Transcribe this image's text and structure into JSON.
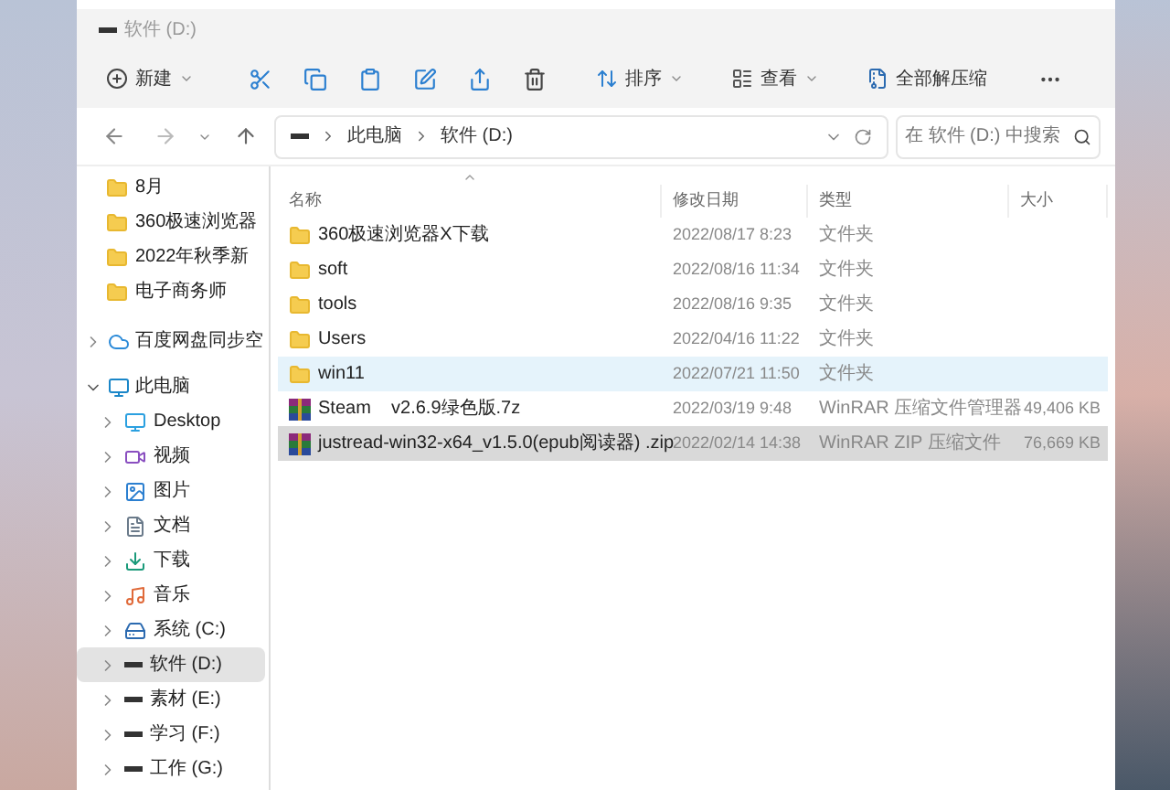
{
  "window": {
    "title": "软件 (D:)"
  },
  "toolbar": {
    "new": "新建",
    "sort": "排序",
    "view": "查看",
    "extract": "全部解压缩"
  },
  "address": {
    "breadcrumbs": [
      "此电脑",
      "软件 (D:)"
    ],
    "search_placeholder": "在 软件 (D:) 中搜索"
  },
  "sidebar": {
    "quick_access": [
      {
        "label": "8月"
      },
      {
        "label": "360极速浏览器"
      },
      {
        "label": "2022年秋季新"
      },
      {
        "label": "电子商务师"
      }
    ],
    "items": [
      {
        "label": "百度网盘同步空",
        "kind": "cloud",
        "expanded": false
      },
      {
        "label": "此电脑",
        "kind": "pc",
        "expanded": true,
        "children": [
          {
            "label": "Desktop",
            "kind": "desktop",
            "selected": false
          },
          {
            "label": "视频",
            "kind": "video",
            "selected": false
          },
          {
            "label": "图片",
            "kind": "picture",
            "selected": false
          },
          {
            "label": "文档",
            "kind": "document",
            "selected": false
          },
          {
            "label": "下载",
            "kind": "download",
            "selected": false
          },
          {
            "label": "音乐",
            "kind": "music",
            "selected": false
          },
          {
            "label": "系统 (C:)",
            "kind": "system-drive",
            "selected": false
          },
          {
            "label": "软件 (D:)",
            "kind": "drive",
            "selected": true
          },
          {
            "label": "素材 (E:)",
            "kind": "drive",
            "selected": false
          },
          {
            "label": "学习 (F:)",
            "kind": "drive",
            "selected": false
          },
          {
            "label": "工作 (G:)",
            "kind": "drive",
            "selected": false
          }
        ]
      }
    ]
  },
  "table": {
    "columns": [
      "名称",
      "修改日期",
      "类型",
      "大小"
    ],
    "rows": [
      {
        "name": "360极速浏览器X下载",
        "date": "2022/08/17 8:23",
        "type": "文件夹",
        "kind": "folder",
        "selected": false,
        "hovered": false
      },
      {
        "name": "soft",
        "date": "2022/08/16 11:34",
        "type": "文件夹",
        "kind": "folder",
        "selected": false,
        "hovered": false
      },
      {
        "name": "tools",
        "date": "2022/08/16 9:35",
        "type": "文件夹",
        "kind": "folder",
        "selected": false,
        "hovered": false
      },
      {
        "name": "Users",
        "date": "2022/04/16 11:22",
        "type": "文件夹",
        "kind": "folder",
        "selected": false,
        "hovered": false
      },
      {
        "name": "win11",
        "date": "2022/07/21 11:50",
        "type": "文件夹",
        "kind": "folder",
        "selected": false,
        "hovered": true
      },
      {
        "name": "Steam    v2.6.9绿色版.7z",
        "date": "2022/03/19 9:48",
        "type": "WinRAR 压缩文件管理器",
        "size": "49,406 KB",
        "kind": "archive",
        "selected": false,
        "hovered": false
      },
      {
        "name": "justread-win32-x64_v1.5.0(epub阅读器) .zip",
        "date": "2022/02/14 14:38",
        "type": "WinRAR ZIP 压缩文件",
        "size": "76,669 KB",
        "kind": "archive",
        "selected": true,
        "hovered": false
      }
    ]
  }
}
